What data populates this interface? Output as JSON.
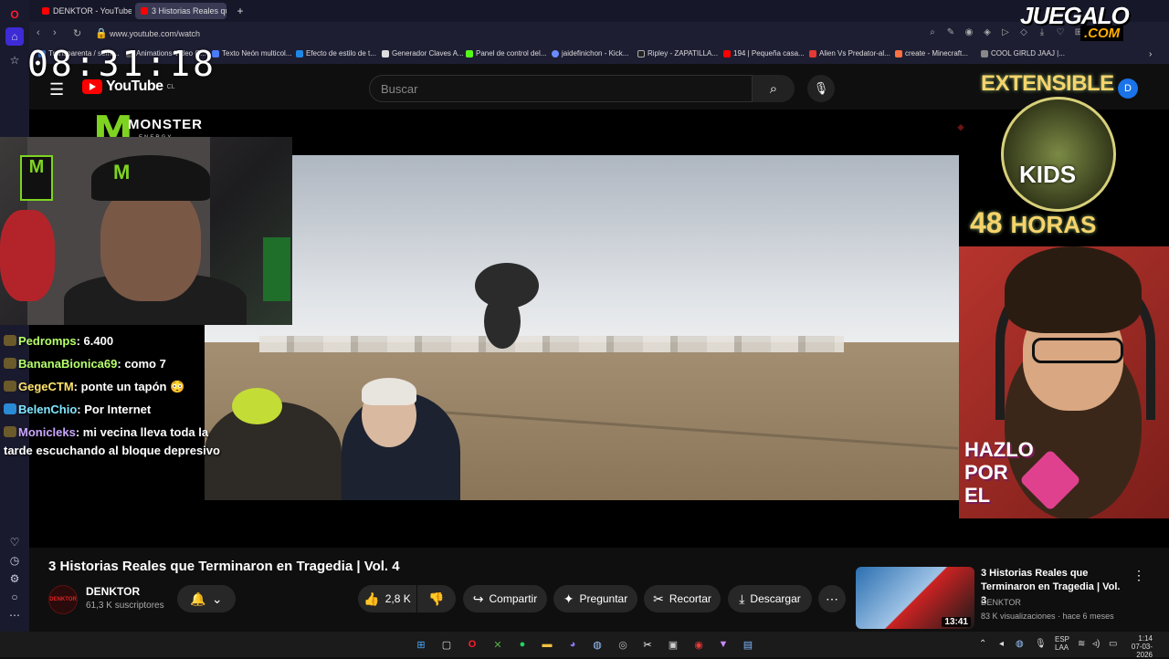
{
  "clock": "08:31:18",
  "browser": {
    "tabs": [
      {
        "label": "DENKTOR - YouTube"
      },
      {
        "label": "3 Historias Reales que"
      }
    ],
    "new_tab": "+",
    "url": "www.youtube.com/watch",
    "bookmarks": [
      {
        "label": "Transparenta / semi..."
      },
      {
        "label": "Animations Video C..."
      },
      {
        "label": "Texto Neón multicol..."
      },
      {
        "label": "Efecto de estilo de t..."
      },
      {
        "label": "Generador Claves A..."
      },
      {
        "label": "Panel de control del..."
      },
      {
        "label": "jaidefinichon - Kick..."
      },
      {
        "label": "Ripley - ZAPATILLA..."
      },
      {
        "label": "194 | Pequeña casa..."
      },
      {
        "label": "Alien Vs Predator-al..."
      },
      {
        "label": "create - Minecraft..."
      },
      {
        "label": "COOL GIRLD JAAJ |..."
      }
    ]
  },
  "youtube": {
    "logo_text": "YouTube",
    "country": "CL",
    "search_placeholder": "Buscar",
    "avatar_letter": "D"
  },
  "overlay": {
    "monster_brand": "MONSTER",
    "monster_sub": "ENERGY",
    "promo_top": "EXTENSIBLE",
    "promo_kids": "KIDS",
    "promo_hours_num": "48",
    "promo_hours_word": "HORAS",
    "hazlo": [
      "HAZLO",
      "POR",
      "EL"
    ],
    "watermark_main": "JUEGALO",
    "watermark_sub": ".COM"
  },
  "chat": [
    {
      "user": "Pedromps",
      "msg": ": 6.400"
    },
    {
      "user": "BananaBionica69",
      "msg": ": como 7"
    },
    {
      "user": "GegeCTM",
      "msg": ": ponte un tapón 😳"
    },
    {
      "user": "BelenChio",
      "msg": ": Por Internet"
    },
    {
      "user": "Monicleks",
      "msg": ": mi vecina lleva toda la"
    },
    {
      "user": "",
      "msg": "tarde escuchando al bloque depresivo"
    }
  ],
  "video": {
    "title": "3 Historias Reales que Terminaron en Tragedia | Vol. 4",
    "channel": "DENKTOR",
    "subscribers": "61,3 K suscriptores",
    "likes": "2,8 K",
    "share": "Compartir",
    "ask": "Preguntar",
    "clip": "Recortar",
    "download": "Descargar"
  },
  "recommended": {
    "title": "3 Historias Reales que Terminaron en Tragedia | Vol. 3",
    "channel": "DENKTOR",
    "meta": "83 K visualizaciones · hace 6 meses",
    "duration": "13:41"
  },
  "taskbar": {
    "lang": "ESP",
    "lang_sub": "LAA",
    "time": "1:14",
    "date": "07-03-2026"
  }
}
